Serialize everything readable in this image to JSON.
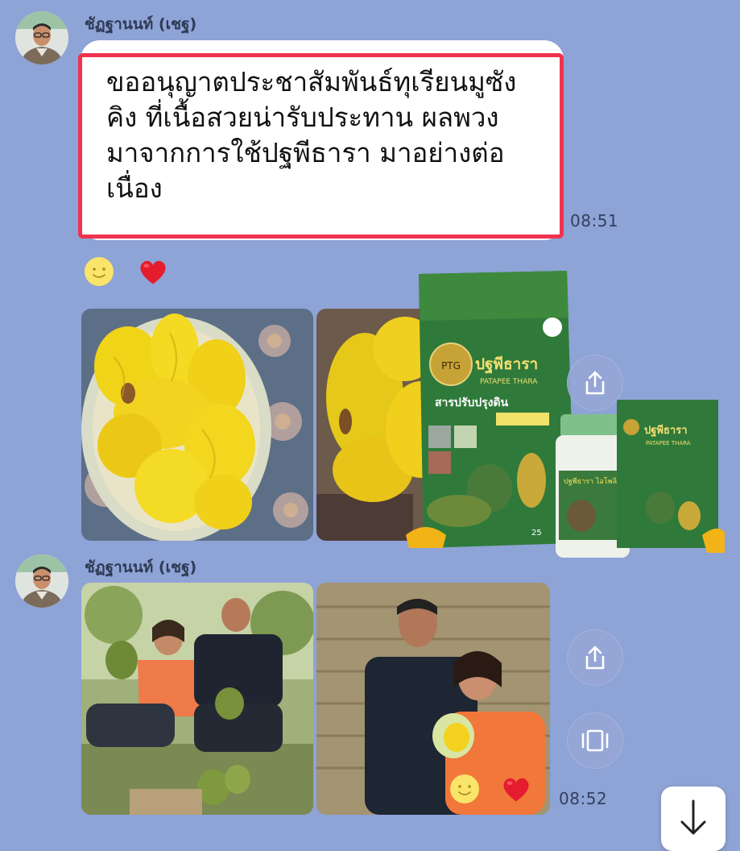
{
  "messages": [
    {
      "sender": "ชัฏฐานนท์ (เชฐ)",
      "text": "ขออนุญาตประชาสัมพันธ์ทุเรียนมูซัง\nคิง ที่เนื้อสวยน่ารับประทาน ผลพวง\nมาจากการใช้ปฐพีธารา  มาอย่างต่อ\nเนื่อง",
      "time": "08:51",
      "reactions": [
        "smile-emoji",
        "heart-emoji"
      ]
    },
    {
      "sender": "ชัฏฐานนท์ (เชฐ)",
      "time": "08:52",
      "reactions": [
        "smile-emoji",
        "heart-emoji"
      ]
    }
  ],
  "products": {
    "bag_brand": "ปฐพีธารา",
    "bag_brand_en": "PATAPEE THARA",
    "bag_type": "สารปรับปรุงดิน",
    "bag_weight": "25",
    "bottle_label": "ปฐพีธารา ไอโพลิ",
    "box_brand": "ปฐพีธารา",
    "box_brand_en": "PATAPEE THARA",
    "logo_text": "PTG"
  },
  "colors": {
    "background": "#8ea3d6",
    "highlight_border": "#f0334e",
    "bag_green": "#2f7a3a",
    "durian_flesh": "#f2d21e"
  },
  "icons": {
    "share": "share-icon",
    "slideshow": "slideshow-icon",
    "scroll_down": "arrow-down-icon"
  }
}
